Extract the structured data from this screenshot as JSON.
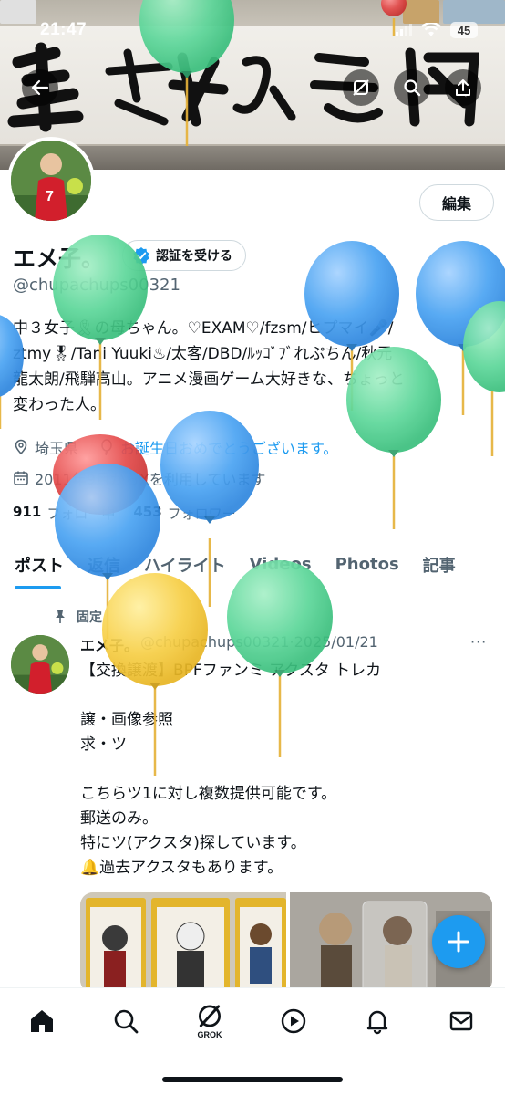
{
  "status_bar": {
    "time": "21:47",
    "battery": "45"
  },
  "profile": {
    "display_name": "エメ子。",
    "verify_button": "認証を受ける",
    "handle": "@chupachups00321",
    "edit_button": "編集",
    "bio_lines": [
      "中３女子🎗の母ちゃん。♡EXAM♡/fzsm/ヒプマイ🎤/",
      "ztmy🎖/Tani Yuuki♨/太客/DBD/ﾙｯｺﾞﾌﾞれぷちん/秋元",
      "龍太朗/飛騨高山。アニメ漫画ゲーム大好きな、ちょっと",
      "変わった人。"
    ],
    "location": "埼玉県",
    "birthday_text": "お誕生日おめでとうございます。",
    "joined_text": "2011年9月からXを利用しています",
    "following_count": "911",
    "following_label": "フォロー中",
    "followers_count": "453",
    "followers_label": "フォロワー"
  },
  "tabs": [
    "ポスト",
    "返信",
    "ハイライト",
    "Videos",
    "Photos",
    "記事"
  ],
  "active_tab": "ポスト",
  "pinned_post": {
    "pinned_label": "固定",
    "author_name": "エメ子。",
    "author_handle": "@chupachups00321",
    "date": "·2025/01/21",
    "more": "···",
    "lines": [
      "【交換譲渡】BPFファンミ アクスタ トレカ",
      "",
      "譲・画像参照",
      "求・ツ",
      "",
      "こちらツ1に対し複数提供可能です。",
      "郵送のみ。",
      "特にツ(アクスタ)探しています。",
      "🔔過去アクスタもあります。"
    ]
  },
  "bottom_nav": {
    "grok_label": "GROK"
  },
  "icons": [
    "back-arrow-icon",
    "image-off-icon",
    "search-icon",
    "share-icon",
    "verified-badge-icon",
    "location-pin-icon",
    "balloon-icon",
    "calendar-icon",
    "pin-icon",
    "home-icon",
    "grok-icon",
    "play-icon",
    "bell-icon",
    "mail-icon",
    "plus-icon"
  ],
  "colors": {
    "accent": "#1d9bf0",
    "text": "#0f1419",
    "secondary": "#536471"
  }
}
